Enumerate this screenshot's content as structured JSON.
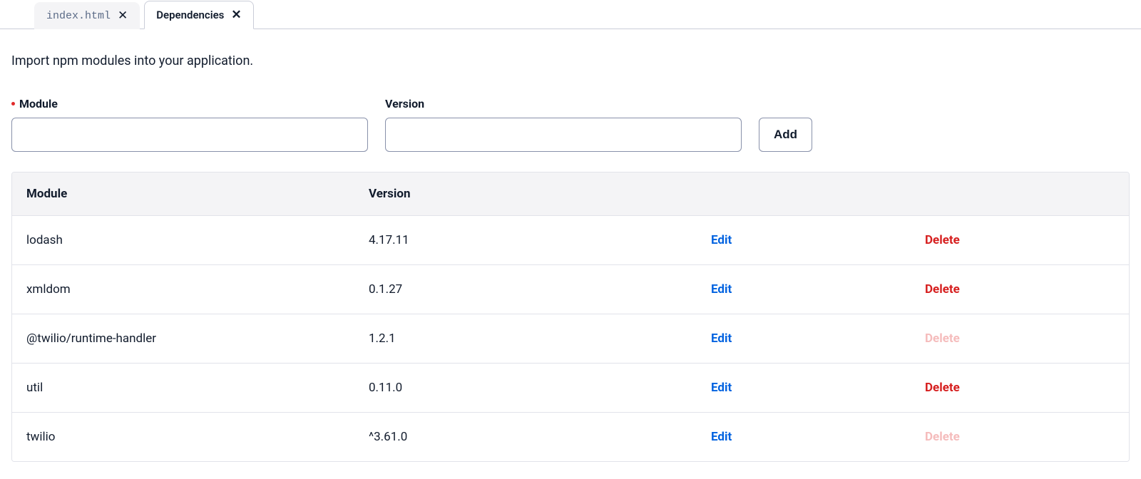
{
  "tabs": [
    {
      "label": "index.html",
      "active": false,
      "code_style": true
    },
    {
      "label": "Dependencies",
      "active": true,
      "code_style": false
    }
  ],
  "description": "Import npm modules into your application.",
  "form": {
    "module_label": "Module",
    "version_label": "Version",
    "module_value": "",
    "version_value": "",
    "add_button": "Add"
  },
  "table": {
    "header": {
      "module": "Module",
      "version": "Version"
    },
    "actions": {
      "edit": "Edit",
      "delete": "Delete"
    },
    "rows": [
      {
        "module": "lodash",
        "version": "4.17.11",
        "delete_disabled": false
      },
      {
        "module": "xmldom",
        "version": "0.1.27",
        "delete_disabled": false
      },
      {
        "module": "@twilio/runtime-handler",
        "version": "1.2.1",
        "delete_disabled": true
      },
      {
        "module": "util",
        "version": "0.11.0",
        "delete_disabled": false
      },
      {
        "module": "twilio",
        "version": "^3.61.0",
        "delete_disabled": true
      }
    ]
  }
}
